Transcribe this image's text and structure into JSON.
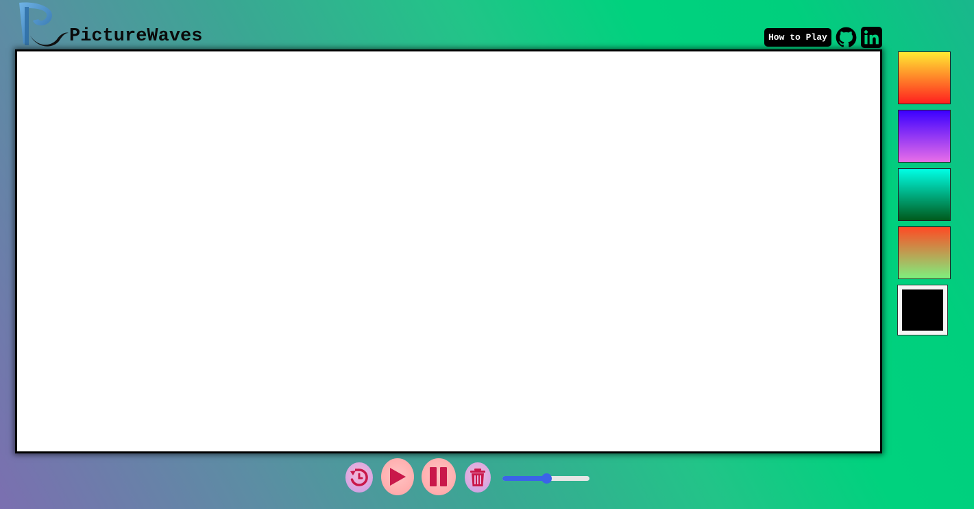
{
  "app": {
    "title": "PictureWaves"
  },
  "header": {
    "how_to_play_label": "How to Play",
    "github_icon": "github-icon",
    "linkedin_icon": "linkedin-icon"
  },
  "palette": {
    "swatches": [
      {
        "name": "sunset",
        "gradient_from": "#ffea33",
        "gradient_to": "#ff1f1f"
      },
      {
        "name": "violet",
        "gradient_from": "#3b00ff",
        "gradient_to": "#e86ee8"
      },
      {
        "name": "teal-forest",
        "gradient_from": "#00ffe6",
        "gradient_to": "#005a1c"
      },
      {
        "name": "ember-meadow",
        "gradient_from": "#ff4a24",
        "gradient_to": "#7ef07e"
      },
      {
        "name": "black",
        "color": "#000000"
      }
    ]
  },
  "controls": {
    "reset_icon": "reset-icon",
    "play_icon": "play-icon",
    "pause_icon": "pause-icon",
    "trash_icon": "trash-icon",
    "icon_color": "#c9184a",
    "speed_value": 0.5
  },
  "colors": {
    "accent": "#3b63e8"
  }
}
